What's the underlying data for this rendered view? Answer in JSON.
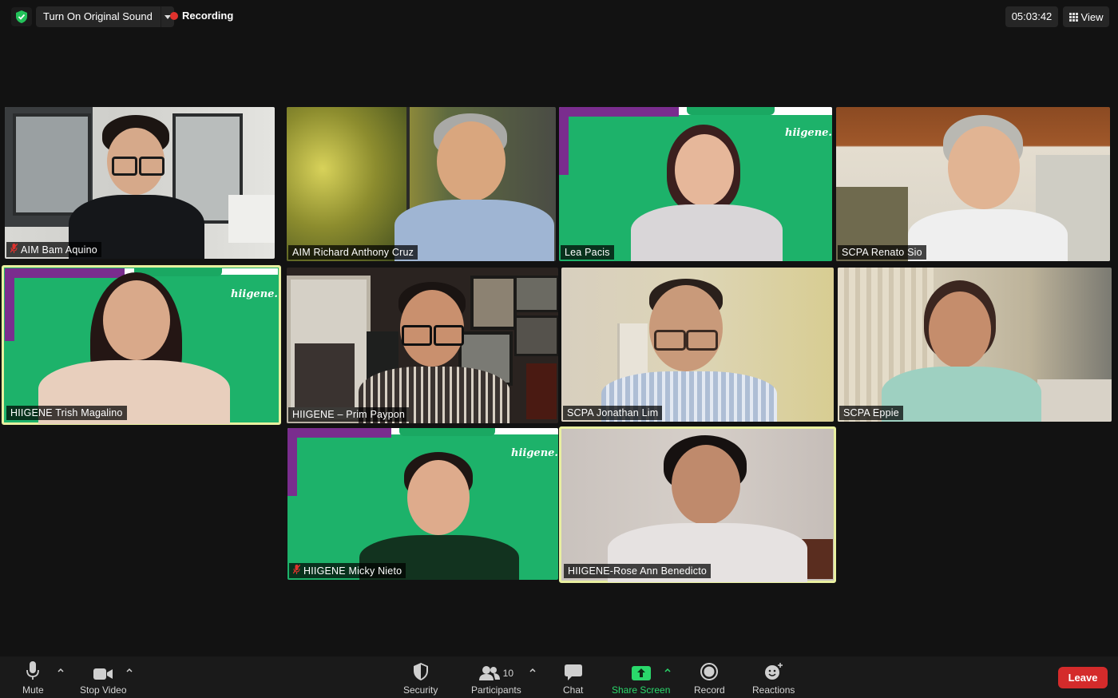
{
  "topbar": {
    "original_sound_label": "Turn On Original Sound",
    "recording_label": "Recording",
    "timer": "05:03:42",
    "view_label": "View"
  },
  "participants": [
    {
      "name": "AIM Bam Aquino",
      "muted": true
    },
    {
      "name": "AIM Richard Anthony Cruz",
      "muted": false
    },
    {
      "name": "Lea Pacis",
      "muted": false
    },
    {
      "name": "SCPA Renato Sio",
      "muted": false
    },
    {
      "name": "HIIGENE Trish Magalino",
      "muted": false,
      "active_speaker": true
    },
    {
      "name": "HIIGENE – Prim Paypon",
      "muted": false
    },
    {
      "name": "SCPA Jonathan Lim",
      "muted": false
    },
    {
      "name": "SCPA Eppie",
      "muted": false
    },
    {
      "name": "HIIGENE Micky Nieto",
      "muted": true
    },
    {
      "name": "HIIGENE-Rose Ann Benedicto",
      "muted": false,
      "active_speaker": true
    }
  ],
  "branding": {
    "logo_text": "hiigene."
  },
  "toolbar": {
    "mute": "Mute",
    "stop_video": "Stop Video",
    "security": "Security",
    "participants": "Participants",
    "participants_count": "10",
    "chat": "Chat",
    "share_screen": "Share Screen",
    "record": "Record",
    "reactions": "Reactions",
    "leave": "Leave"
  },
  "colors": {
    "accent_green": "#2ad86b",
    "leave_red": "#d42b2b",
    "speaker_outline": "#e9f0a0",
    "brand_green": "#1db26a",
    "brand_purple": "#7a2d8e"
  }
}
